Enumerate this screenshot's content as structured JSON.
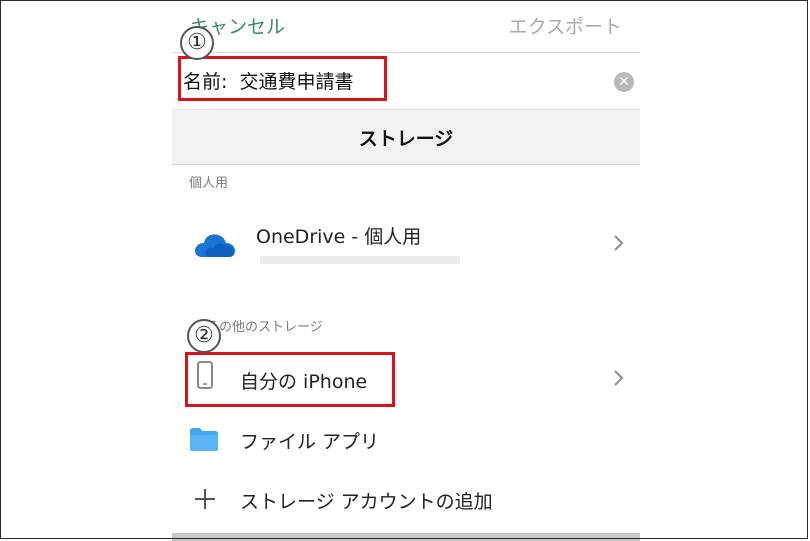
{
  "nav": {
    "cancel_label": "キャンセル",
    "export_label": "エクスポート"
  },
  "name_field": {
    "value": "名前:  交通費申請書",
    "clear_icon": "clear-circle-icon"
  },
  "storage_header": "ストレージ",
  "groups": {
    "personal_label": "個人用",
    "other_label": "その他のストレージ"
  },
  "rows": {
    "onedrive": {
      "label": "OneDrive - 個人用",
      "icon": "onedrive-cloud-icon"
    },
    "iphone": {
      "label": "自分の iPhone",
      "icon": "phone-icon"
    },
    "files": {
      "label": "ファイル アプリ",
      "icon": "folder-icon"
    },
    "add": {
      "label": "ストレージ アカウントの追加",
      "icon": "plus-icon"
    }
  },
  "annotations": {
    "first": "①",
    "second": "②",
    "color": "#d9121c"
  },
  "colors": {
    "accent_green": "#3f8a5e",
    "onedrive_blue": "#1a73d6",
    "folder_blue": "#3fa6f0"
  }
}
